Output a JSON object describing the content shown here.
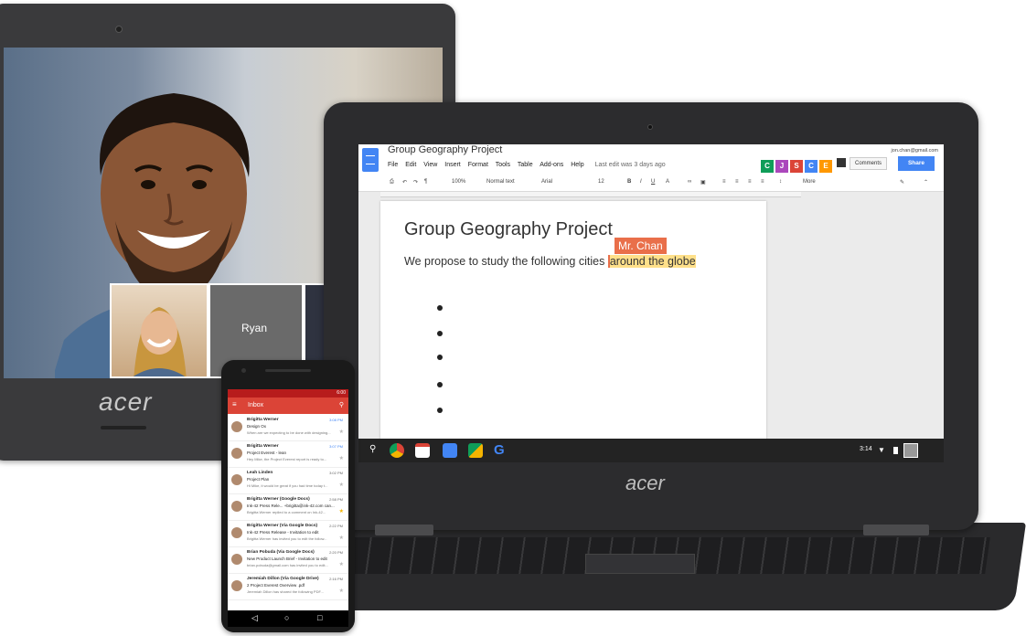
{
  "video_call": {
    "participant_label": "Ryan",
    "device_logo": "acer"
  },
  "docs": {
    "app_icon": "google-docs-icon",
    "document_title": "Group Geography Project",
    "menu": [
      "File",
      "Edit",
      "View",
      "Insert",
      "Format",
      "Tools",
      "Table",
      "Add-ons",
      "Help"
    ],
    "last_edit": "Last edit was 3 days ago",
    "user_email": "jon.chan@gmail.com",
    "collaborators": [
      {
        "initial": "C",
        "color": "#0f9d58"
      },
      {
        "initial": "J",
        "color": "#ab47bc"
      },
      {
        "initial": "S",
        "color": "#db4437"
      },
      {
        "initial": "C",
        "color": "#4285f4"
      },
      {
        "initial": "E",
        "color": "#ff9800"
      }
    ],
    "comments_label": "Comments",
    "share_label": "Share",
    "toolbar": {
      "zoom": "100%",
      "style": "Normal text",
      "font": "Arial",
      "size": "12",
      "more": "More"
    },
    "heading": "Group Geography Project",
    "cursor_owner": "Mr. Chan",
    "body_text": "We propose to study the following cities ",
    "highlighted_text": "around the globe",
    "bullet_count": 5,
    "device_logo": "acer",
    "shelf": {
      "time": "3:14",
      "apps": [
        "search-icon",
        "chrome-icon",
        "gmail-icon",
        "calendar-icon",
        "maps-icon",
        "google-icon"
      ]
    }
  },
  "phone": {
    "status_time": "6:00",
    "inbox_title": "Inbox",
    "emails": [
      {
        "sender": "Brigitta Werner",
        "subject": "Design Ox",
        "snippet": "When are we expecting to be done with designing...",
        "time": "3:08 PM",
        "unread": true,
        "starred": false
      },
      {
        "sender": "Brigitta Werner",
        "subject": "Project Everest - lean",
        "snippet": "Hey Mike, the Project Everest report is ready to...",
        "time": "3:07 PM",
        "unread": true,
        "starred": false
      },
      {
        "sender": "Leah Linden",
        "subject": "Project Plan",
        "snippet": "Hi Mike, it would be great if you had time today t...",
        "time": "3:02 PM",
        "unread": false,
        "starred": false
      },
      {
        "sender": "Brigitta Werner (Google Docs)",
        "subject": "Ink-42 Press Rele... +brigitta@ink-42.com can...",
        "snippet": "Brigitta Werner replied to a comment on Ink-42...",
        "time": "2:58 PM",
        "unread": false,
        "starred": true
      },
      {
        "sender": "Brigitta Werner (Via Google Docs)",
        "subject": "Ink-42 Press Release - Invitation to edit",
        "snippet": "Brigitta Werner has invited you to edit the follow...",
        "time": "2:22 PM",
        "unread": false,
        "starred": false
      },
      {
        "sender": "Brian Pobuda (Via Google Docs)",
        "subject": "New Product Launch Brief - Invitation to edit",
        "snippet": "brian.pobuda@gmail.com has invited you to edit...",
        "time": "2:20 PM",
        "unread": false,
        "starred": false
      },
      {
        "sender": "Jeremiah Dillon (Via Google Drive)",
        "subject": "2 Project Everest Overview .pdf",
        "snippet": "Jeremiah Dillon has shared the following PDF...",
        "time": "2:16 PM",
        "unread": false,
        "starred": false
      }
    ]
  }
}
